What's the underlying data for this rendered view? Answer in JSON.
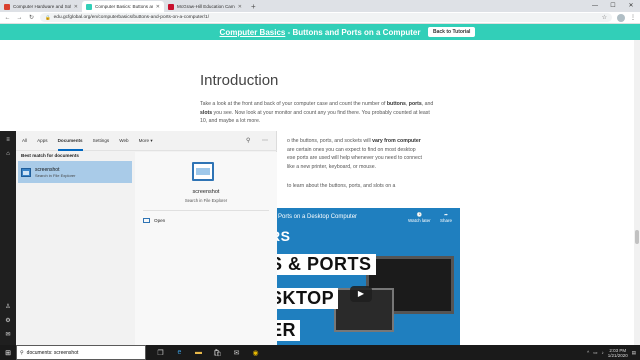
{
  "browser": {
    "tabs": [
      {
        "label": "Computer Hardware and Softw...",
        "favicon_color": "#d9412f",
        "active": false
      },
      {
        "label": "Computer Basics: Buttons and P...",
        "favicon_color": "#32cfb8",
        "active": true
      },
      {
        "label": "McGraw-Hill Education Campus",
        "favicon_color": "#c8102e",
        "active": false
      }
    ],
    "new_tab": "+",
    "url": "edu.gcfglobal.org/en/computerbasics/buttons-and-ports-on-a-computer/1/",
    "window_controls": {
      "minimize": "—",
      "maximize": "☐",
      "close": "✕"
    }
  },
  "banner": {
    "title_link": "Computer Basics",
    "title_rest": " - Buttons and Ports on a Computer",
    "back_button": "Back to Tutorial",
    "color": "#32cfb8"
  },
  "article": {
    "heading": "Introduction",
    "p1_a": "Take a look at the front and back of your computer case and count the number of ",
    "p1_b1": "buttons",
    "p1_c": ", ",
    "p1_b2": "ports",
    "p1_d": ", and ",
    "p1_b3": "slots",
    "p1_e": " you see. Now look at your monitor and count any you find there. You probably counted at least 10, and maybe a lot more.",
    "p2_a": "o the buttons, ports, and sockets will ",
    "p2_b": "vary from computer",
    "p2_c": " are certain ones you can expect to find on most desktop",
    "p2_d": "ese ports are used will help whenever you need to connect",
    "p2_e": " like a new printer, keyboard, or mouse.",
    "p3": "to learn about the buttons, ports, and slots on a"
  },
  "video": {
    "title": "Ports on a Desktop Computer",
    "watch_later": "Watch later",
    "share": "Share",
    "big1": "RS",
    "big2": "S & PORTS",
    "big3": "SKTOP",
    "big4": "ER",
    "play": "▶"
  },
  "search_panel": {
    "tabs": [
      "All",
      "Apps",
      "Documents",
      "Settings",
      "Web",
      "More ▾"
    ],
    "selected_tab": "Documents",
    "best_match_label": "Best match for documents",
    "result_name": "screenshot",
    "result_sub": "Search in File Explorer",
    "detail_name": "screenshot",
    "detail_sub": "Search in File Explorer",
    "open_label": "Open"
  },
  "taskbar": {
    "search_text": "documents: screenshot",
    "clock_time": "2:03 PM",
    "clock_date": "1/21/2020"
  }
}
